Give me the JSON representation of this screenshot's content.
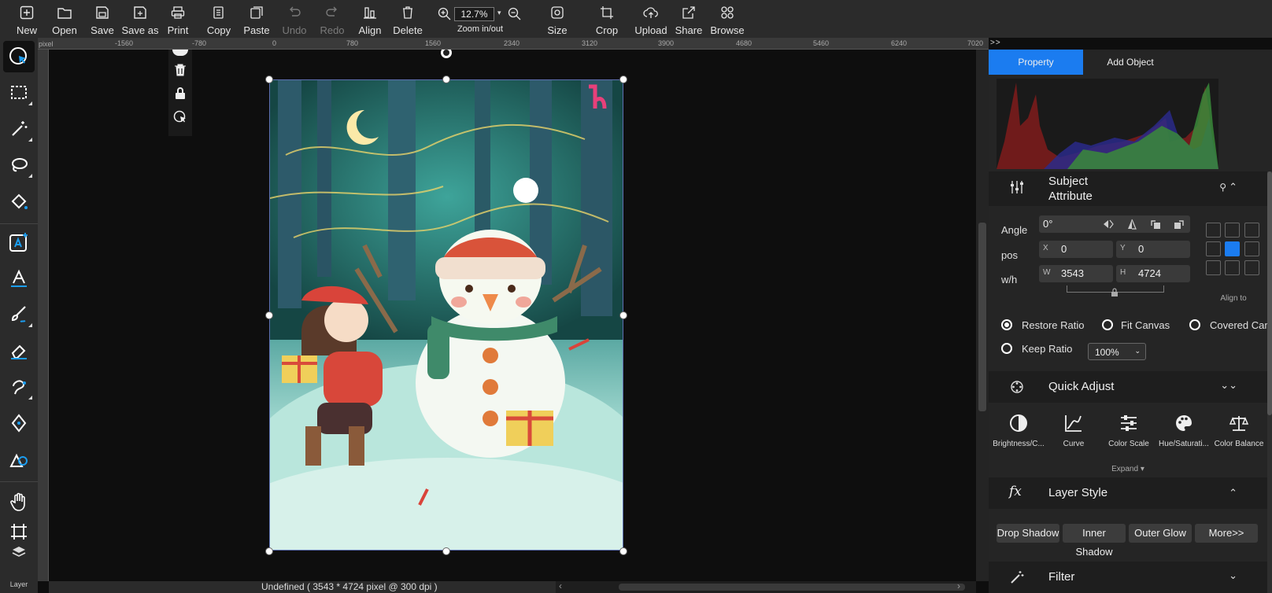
{
  "toolbar": {
    "new": "New",
    "open": "Open",
    "save": "Save",
    "save_as": "Save as",
    "print": "Print",
    "copy": "Copy",
    "paste": "Paste",
    "undo": "Undo",
    "redo": "Redo",
    "align": "Align",
    "delete": "Delete",
    "zoom_value": "12.7%",
    "zoom_label": "Zoom in/out",
    "size": "Size",
    "crop": "Crop",
    "upload": "Upload",
    "share": "Share",
    "browse": "Browse"
  },
  "ruler": {
    "unit": "pixel",
    "ticks": [
      "-1560",
      "-780",
      "0",
      "780",
      "1560",
      "2340",
      "3120",
      "3900",
      "4680",
      "5460",
      "6240",
      "7020"
    ]
  },
  "panel_expand": ">>",
  "left_tools": {
    "layer_label": "Layer"
  },
  "status": {
    "text": "Undefined ( 3543 * 4724 pixel @ 300 dpi )"
  },
  "panel": {
    "tabs": [
      "Property",
      "Add Object"
    ],
    "subject_attribute": {
      "title": "Subject Attribute",
      "angle_label": "Angle",
      "angle_value": "0°",
      "pos_label": "pos",
      "x_prefix": "X",
      "x_value": "0",
      "y_prefix": "Y",
      "y_value": "0",
      "wh_label": "w/h",
      "w_prefix": "W",
      "w_value": "3543",
      "h_prefix": "H",
      "h_value": "4724",
      "align_to": "Align to",
      "restore_ratio": "Restore Ratio",
      "fit_canvas": "Fit Canvas",
      "covered_canvas": "Covered Canv",
      "keep_ratio": "Keep Ratio",
      "ratio_value": "100%"
    },
    "quick_adjust": {
      "title": "Quick Adjust",
      "items": [
        "Brightness/C...",
        "Curve",
        "Color Scale",
        "Hue/Saturati...",
        "Color Balance"
      ],
      "expand": "Expand ▾"
    },
    "layer_style": {
      "title": "Layer Style",
      "buttons": [
        "Drop Shadow",
        "Inner Shadow",
        "Outer Glow",
        "More>>"
      ]
    },
    "filter": {
      "title": "Filter"
    }
  },
  "colors": {
    "accent": "#1b7cf0",
    "toolbar_bg": "#2b2b2b",
    "canvas_bg": "#0e0e0e",
    "panel_bg": "#252525"
  }
}
